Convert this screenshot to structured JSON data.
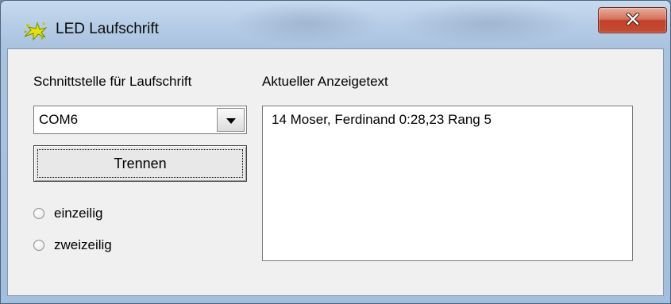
{
  "window": {
    "title": "LED Laufschrift",
    "icon": "led-sparkle-icon",
    "close_icon": "close-icon"
  },
  "interface": {
    "label": "Schnittstelle für Laufschrift",
    "port_value": "COM6",
    "disconnect_label": "Trennen"
  },
  "mode": {
    "options": [
      "einzeilig",
      "zweizeilig"
    ]
  },
  "display": {
    "label": "Aktueller Anzeigetext",
    "text": "14 Moser, Ferdinand 0:28,23 Rang 5"
  },
  "colors": {
    "titlebar": "#b6cde6",
    "close_button": "#c64c2f",
    "client_background": "#f0f0f0"
  }
}
